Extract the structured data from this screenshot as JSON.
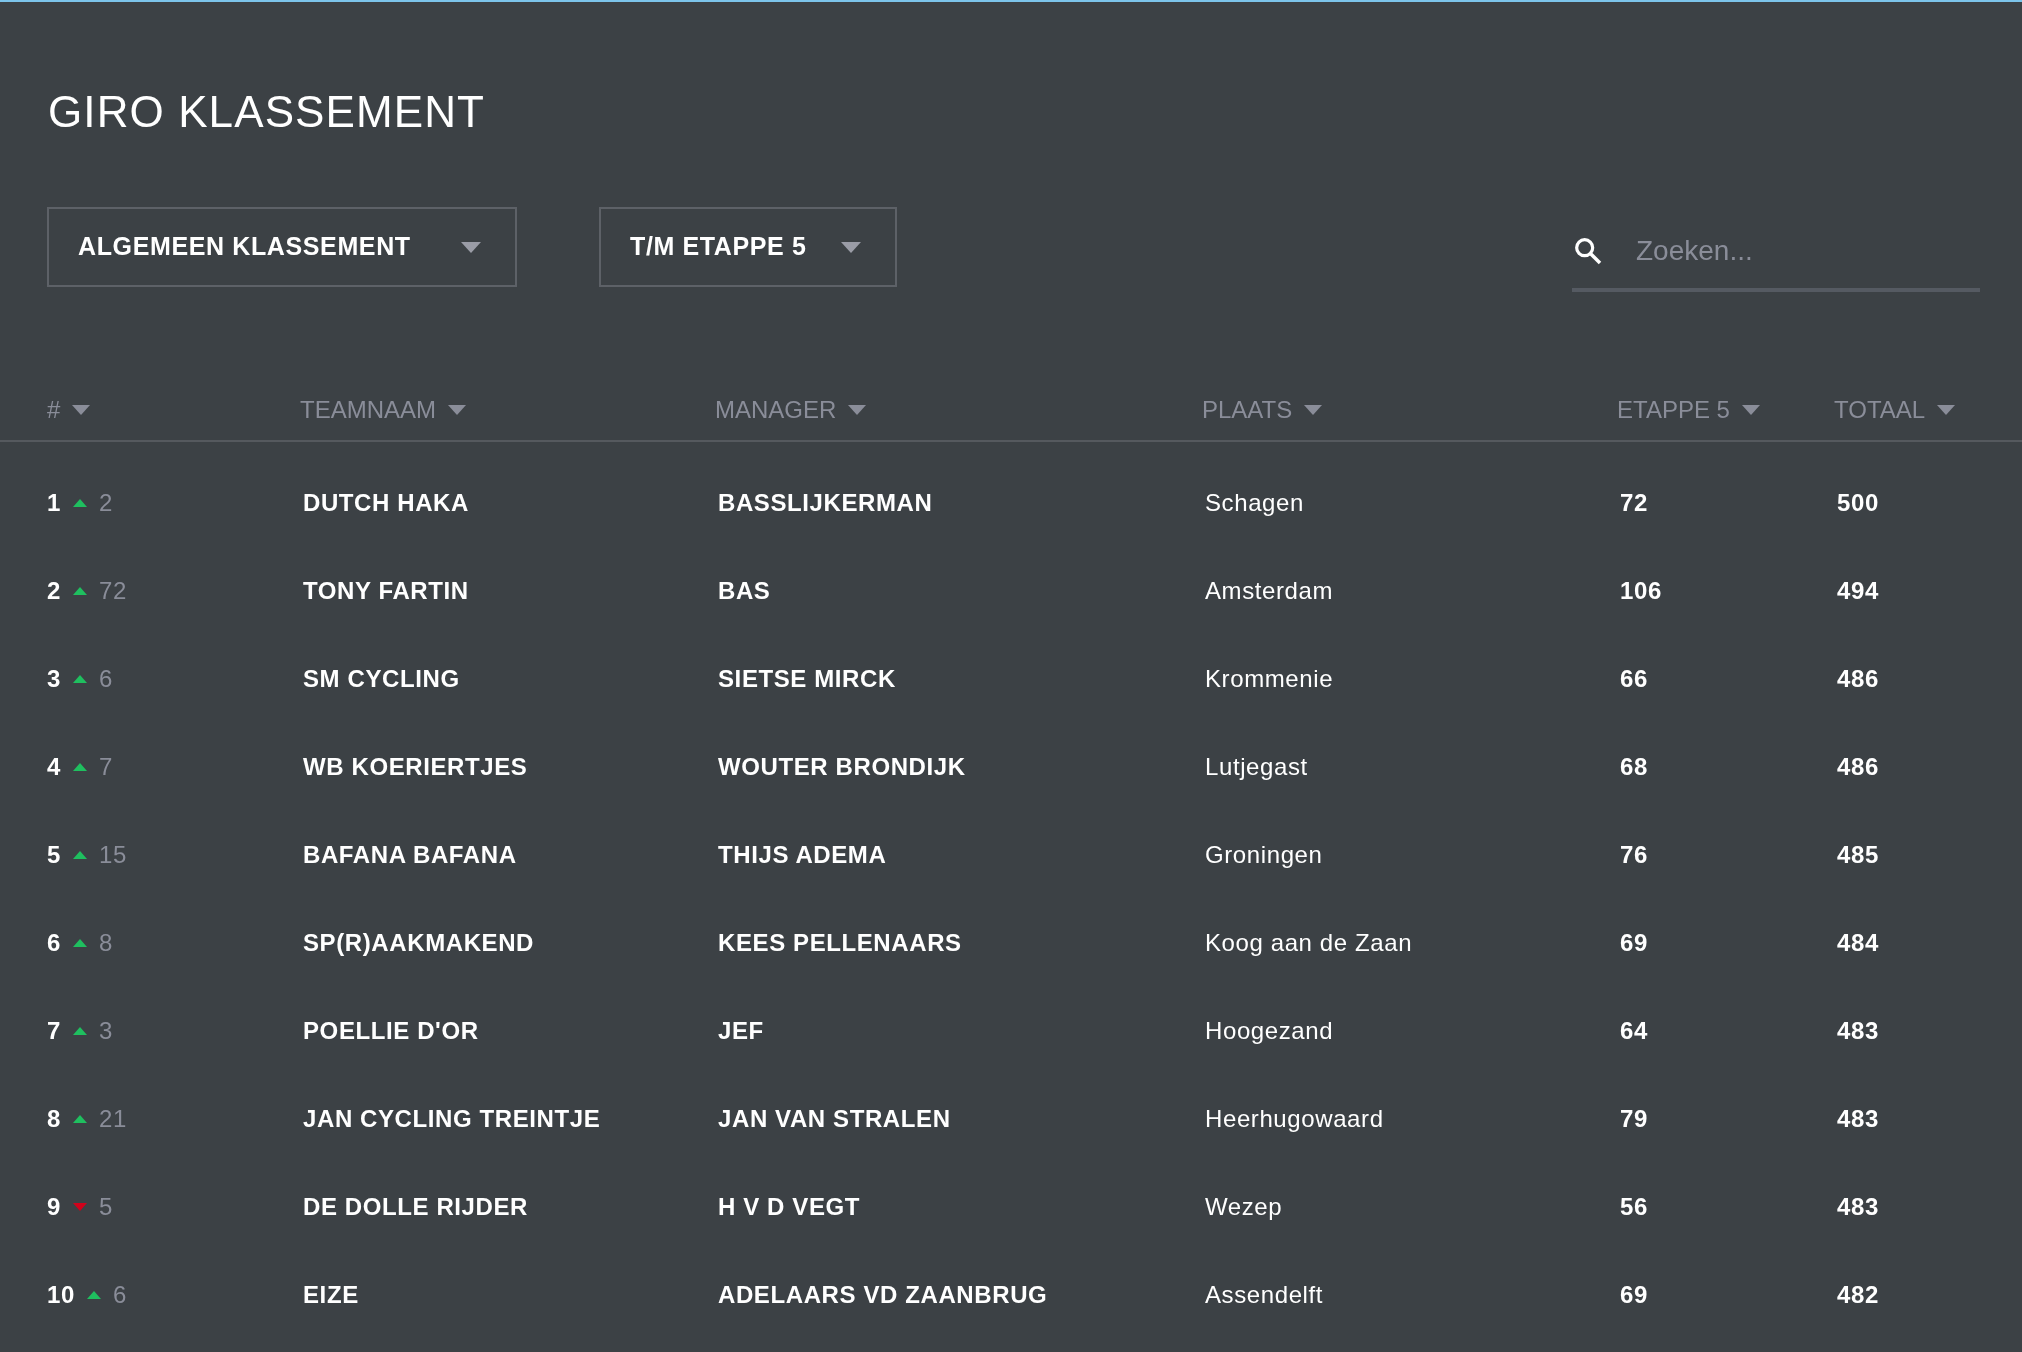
{
  "title": "GIRO KLASSEMENT",
  "filters": [
    {
      "label": "ALGEMEEN KLASSEMENT"
    },
    {
      "label": "T/M ETAPPE 5"
    }
  ],
  "search": {
    "placeholder": "Zoeken..."
  },
  "columns": [
    "#",
    "TEAMNAAM",
    "MANAGER",
    "PLAATS",
    "ETAPPE 5",
    "TOTAAL"
  ],
  "rows": [
    {
      "rank": "1",
      "kind": "up",
      "change": "2",
      "team": "DUTCH HAKA",
      "manager": "BASSLIJKERMAN",
      "place": "Schagen",
      "stage": "72",
      "total": "500"
    },
    {
      "rank": "2",
      "kind": "up",
      "change": "72",
      "team": "TONY FARTIN",
      "manager": "BAS",
      "place": "Amsterdam",
      "stage": "106",
      "total": "494"
    },
    {
      "rank": "3",
      "kind": "up",
      "change": "6",
      "team": "SM CYCLING",
      "manager": "SIETSE MIRCK",
      "place": "Krommenie",
      "stage": "66",
      "total": "486"
    },
    {
      "rank": "4",
      "kind": "up",
      "change": "7",
      "team": "WB KOERIERTJES",
      "manager": "WOUTER BRONDIJK",
      "place": "Lutjegast",
      "stage": "68",
      "total": "486"
    },
    {
      "rank": "5",
      "kind": "up",
      "change": "15",
      "team": "BAFANA BAFANA",
      "manager": "THIJS ADEMA",
      "place": "Groningen",
      "stage": "76",
      "total": "485"
    },
    {
      "rank": "6",
      "kind": "up",
      "change": "8",
      "team": "SP(R)AAKMAKEND",
      "manager": "KEES PELLENAARS",
      "place": "Koog aan de Zaan",
      "stage": "69",
      "total": "484"
    },
    {
      "rank": "7",
      "kind": "up",
      "change": "3",
      "team": "POELLIE D'OR",
      "manager": "JEF",
      "place": "Hoogezand",
      "stage": "64",
      "total": "483"
    },
    {
      "rank": "8",
      "kind": "up",
      "change": "21",
      "team": "JAN CYCLING TREINTJE",
      "manager": "JAN VAN STRALEN",
      "place": "Heerhugowaard",
      "stage": "79",
      "total": "483"
    },
    {
      "rank": "9",
      "kind": "down",
      "change": "5",
      "team": "DE DOLLE RIJDER",
      "manager": "H V D VEGT",
      "place": "Wezep",
      "stage": "56",
      "total": "483"
    },
    {
      "rank": "10",
      "kind": "up",
      "change": "6",
      "team": "EIZE",
      "manager": "ADELAARS VD ZAANBRUG",
      "place": "Assendelft",
      "stage": "69",
      "total": "482"
    }
  ]
}
